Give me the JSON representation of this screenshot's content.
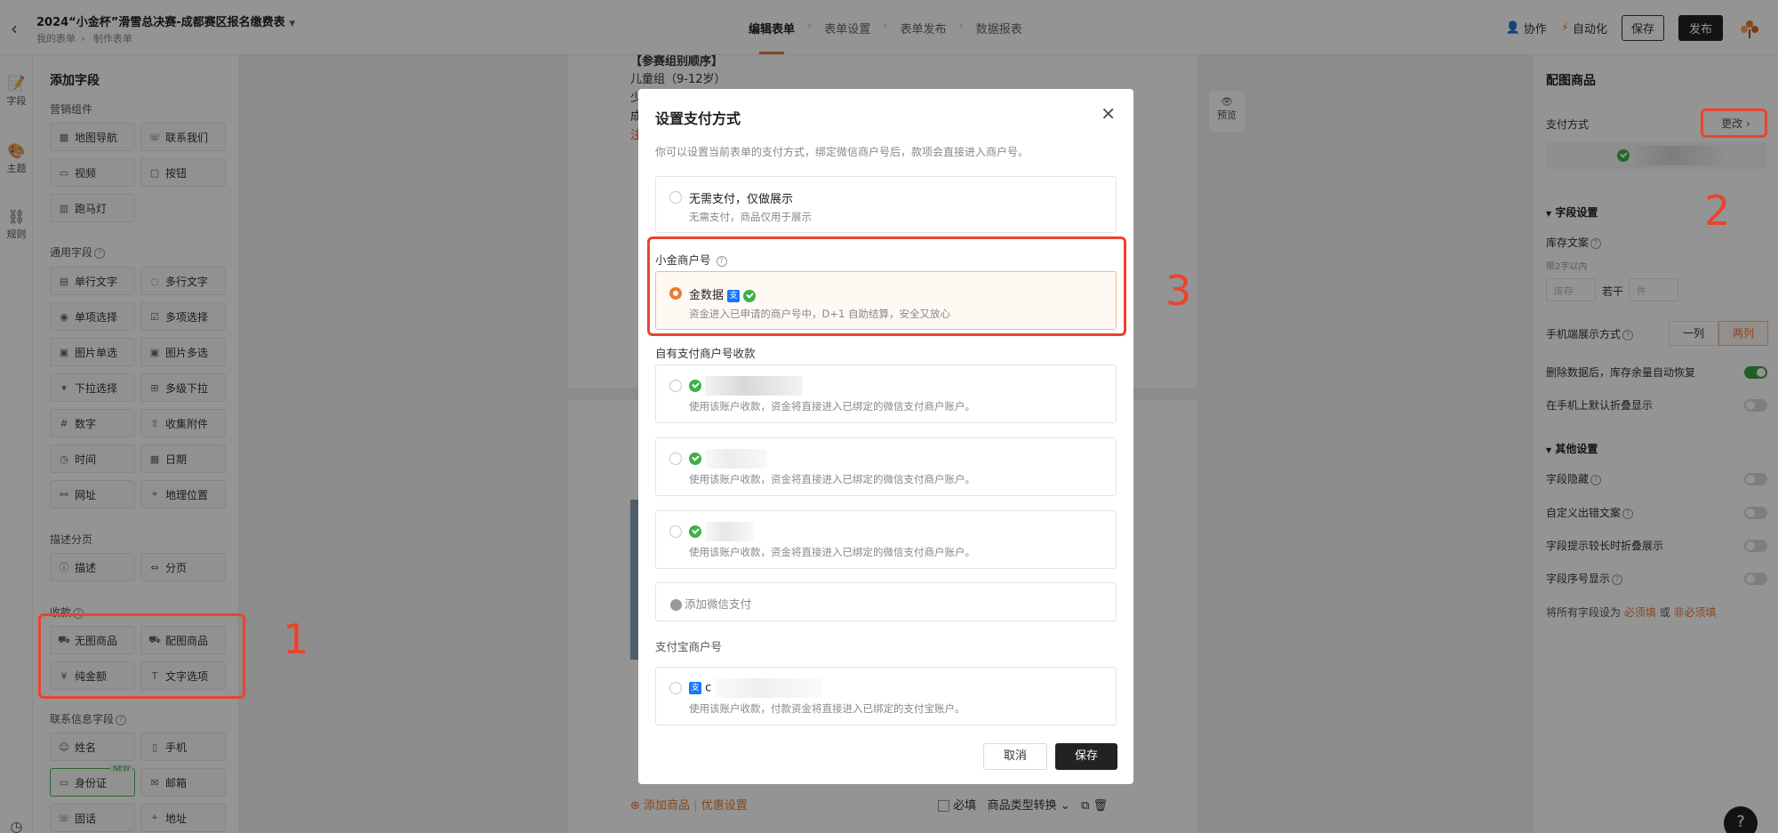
{
  "header": {
    "title": "2024“小金杯”滑雪总决赛-成都赛区报名缴费表",
    "breadcrumb": [
      "我的表单",
      "制作表单"
    ],
    "steps": [
      "编辑表单",
      "表单设置",
      "表单发布",
      "数据报表"
    ],
    "collab_label": "协作",
    "automation_label": "自动化",
    "save_label": "保存",
    "publish_label": "发布"
  },
  "rail": [
    "字段",
    "主题",
    "规则"
  ],
  "fieldpanel": {
    "title": "添加字段",
    "sections": {
      "marketing": "营销组件",
      "general": "通用字段",
      "description": "描述分页",
      "payment": "收款",
      "contact": "联系信息字段"
    },
    "marketing_items": [
      "地图导航",
      "联系我们",
      "视频",
      "按钮",
      "跑马灯"
    ],
    "general_items": [
      "单行文字",
      "多行文字",
      "单项选择",
      "多项选择",
      "图片单选",
      "图片多选",
      "下拉选择",
      "多级下拉",
      "数字",
      "收集附件",
      "时间",
      "日期",
      "网址",
      "地理位置"
    ],
    "description_items": [
      "描述",
      "分页"
    ],
    "payment_items": [
      "无图商品",
      "配图商品",
      "纯金额",
      "文字选项"
    ],
    "contact_items": [
      "姓名",
      "手机",
      "身份证",
      "邮箱",
      "固话",
      "地址"
    ],
    "new_tag": "NEW"
  },
  "canvas": {
    "lines": [
      "【参赛组别顺序】",
      "儿童组（9-12岁）",
      "少",
      "成",
      "注"
    ],
    "bottom_add": "添加商品",
    "bottom_discount": "优惠设置",
    "required_label": "必填",
    "type_convert": "商品类型转换",
    "preview": "预览"
  },
  "rpanel": {
    "title": "配图商品",
    "payment_method": "支付方式",
    "change": "更改",
    "field_settings": "字段设置",
    "stock_text": "库存文案",
    "stock_hint": "限2字以内",
    "stock_placeholder": "库存",
    "some_label": "若干",
    "unit_placeholder": "件",
    "mobile_display": "手机端展示方式",
    "one_col": "一列",
    "two_col": "两列",
    "restore_stock": "删除数据后，库存余量自动恢复",
    "collapse_mobile": "在手机上默认折叠显示",
    "other_settings": "其他设置",
    "hide_field": "字段隐藏",
    "custom_error": "自定义出错文案",
    "collapse_hint": "字段提示较长时折叠展示",
    "show_index": "字段序号显示",
    "set_all_prefix": "将所有字段设为",
    "required": "必须填",
    "or": "或",
    "optional": "非必须填"
  },
  "modal": {
    "title": "设置支付方式",
    "description": "你可以设置当前表单的支付方式，绑定微信商户号后，款项会直接进入商户号。",
    "no_pay_title": "无需支付，仅做展示",
    "no_pay_desc": "无需支付，商品仅用于展示",
    "xiaojin_label": "小金商户号",
    "jinshuju_title": "金数据",
    "jinshuju_desc": "资金进入已申请的商户号中，D+1 自助结算，安全又放心",
    "own_label": "自有支付商户号收款",
    "wechat_desc": "使用该账户收款，资金将直接进入已绑定的微信支付商户账户。",
    "add_wechat": "添加微信支付",
    "alipay_label": "支付宝商户号",
    "alipay_initial": "c",
    "alipay_desc": "使用该账户收款，付款资金将直接进入已绑定的支付宝账户。",
    "cancel": "取消",
    "save": "保存"
  },
  "annotations": [
    "1",
    "2",
    "3"
  ],
  "colors": {
    "accent": "#e97b35",
    "annotation_red": "#e8452c",
    "wechat_green": "#3eb04a",
    "alipay_blue": "#1677ff"
  }
}
